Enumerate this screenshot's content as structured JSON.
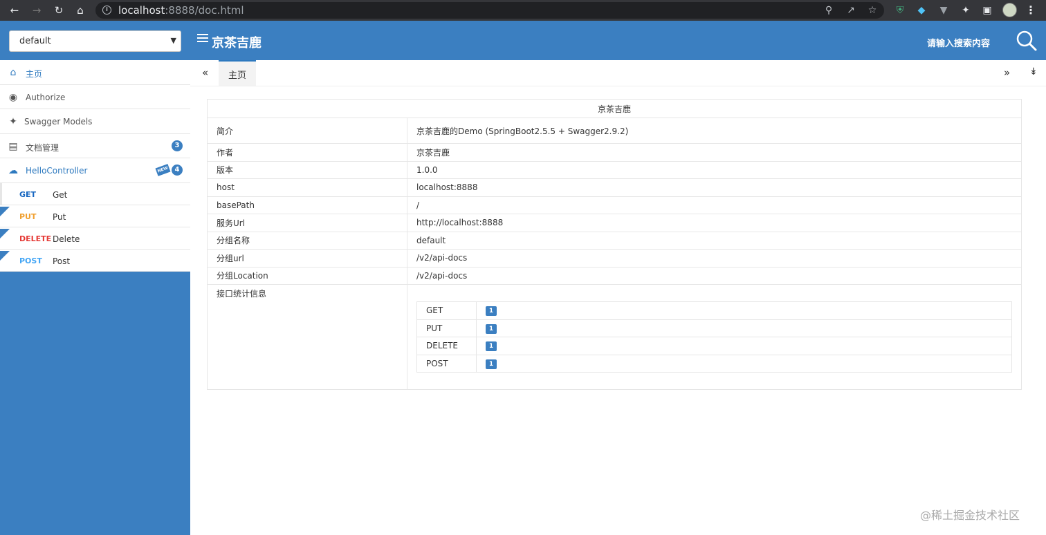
{
  "browser": {
    "url_host": "localhost",
    "url_path": ":8888/doc.html"
  },
  "group_select": {
    "value": "default"
  },
  "header": {
    "title": "京茶吉鹿",
    "search_placeholder": "请输入搜索内容"
  },
  "sidebar": {
    "items": [
      {
        "label": "主页",
        "icon": "home-icon"
      },
      {
        "label": "Authorize",
        "icon": "lock-icon"
      },
      {
        "label": "Swagger Models",
        "icon": "cube-icon"
      },
      {
        "label": "文档管理",
        "icon": "doc-manage-icon",
        "badge": "3"
      },
      {
        "label": "HelloController",
        "icon": "cloud-icon",
        "badge": "4",
        "new_badge": "NEW"
      }
    ],
    "apis": [
      {
        "method": "GET",
        "name": "Get",
        "color": "#1565c0"
      },
      {
        "method": "PUT",
        "name": "Put",
        "color": "#f0a030"
      },
      {
        "method": "DELETE",
        "name": "Delete",
        "color": "#e53935"
      },
      {
        "method": "POST",
        "name": "Post",
        "color": "#42a5f5"
      }
    ]
  },
  "tabs": {
    "active": "主页"
  },
  "info": {
    "title": "京茶吉鹿",
    "rows": [
      {
        "key": "简介",
        "value": "京茶吉鹿的Demo (SpringBoot2.5.5 + Swagger2.9.2)"
      },
      {
        "key": "作者",
        "value": "京茶吉鹿"
      },
      {
        "key": "版本",
        "value": "1.0.0"
      },
      {
        "key": "host",
        "value": "localhost:8888"
      },
      {
        "key": "basePath",
        "value": "/"
      },
      {
        "key": "服务Url",
        "value": "http://localhost:8888"
      },
      {
        "key": "分组名称",
        "value": "default"
      },
      {
        "key": "分组url",
        "value": "/v2/api-docs"
      },
      {
        "key": "分组Location",
        "value": "/v2/api-docs"
      }
    ],
    "stats_label": "接口统计信息",
    "stats": [
      {
        "method": "GET",
        "count": "1"
      },
      {
        "method": "PUT",
        "count": "1"
      },
      {
        "method": "DELETE",
        "count": "1"
      },
      {
        "method": "POST",
        "count": "1"
      }
    ]
  },
  "watermark": "@稀土掘金技术社区",
  "colors": {
    "brand": "#3b7fc1",
    "active_text": "#2d79bf"
  }
}
